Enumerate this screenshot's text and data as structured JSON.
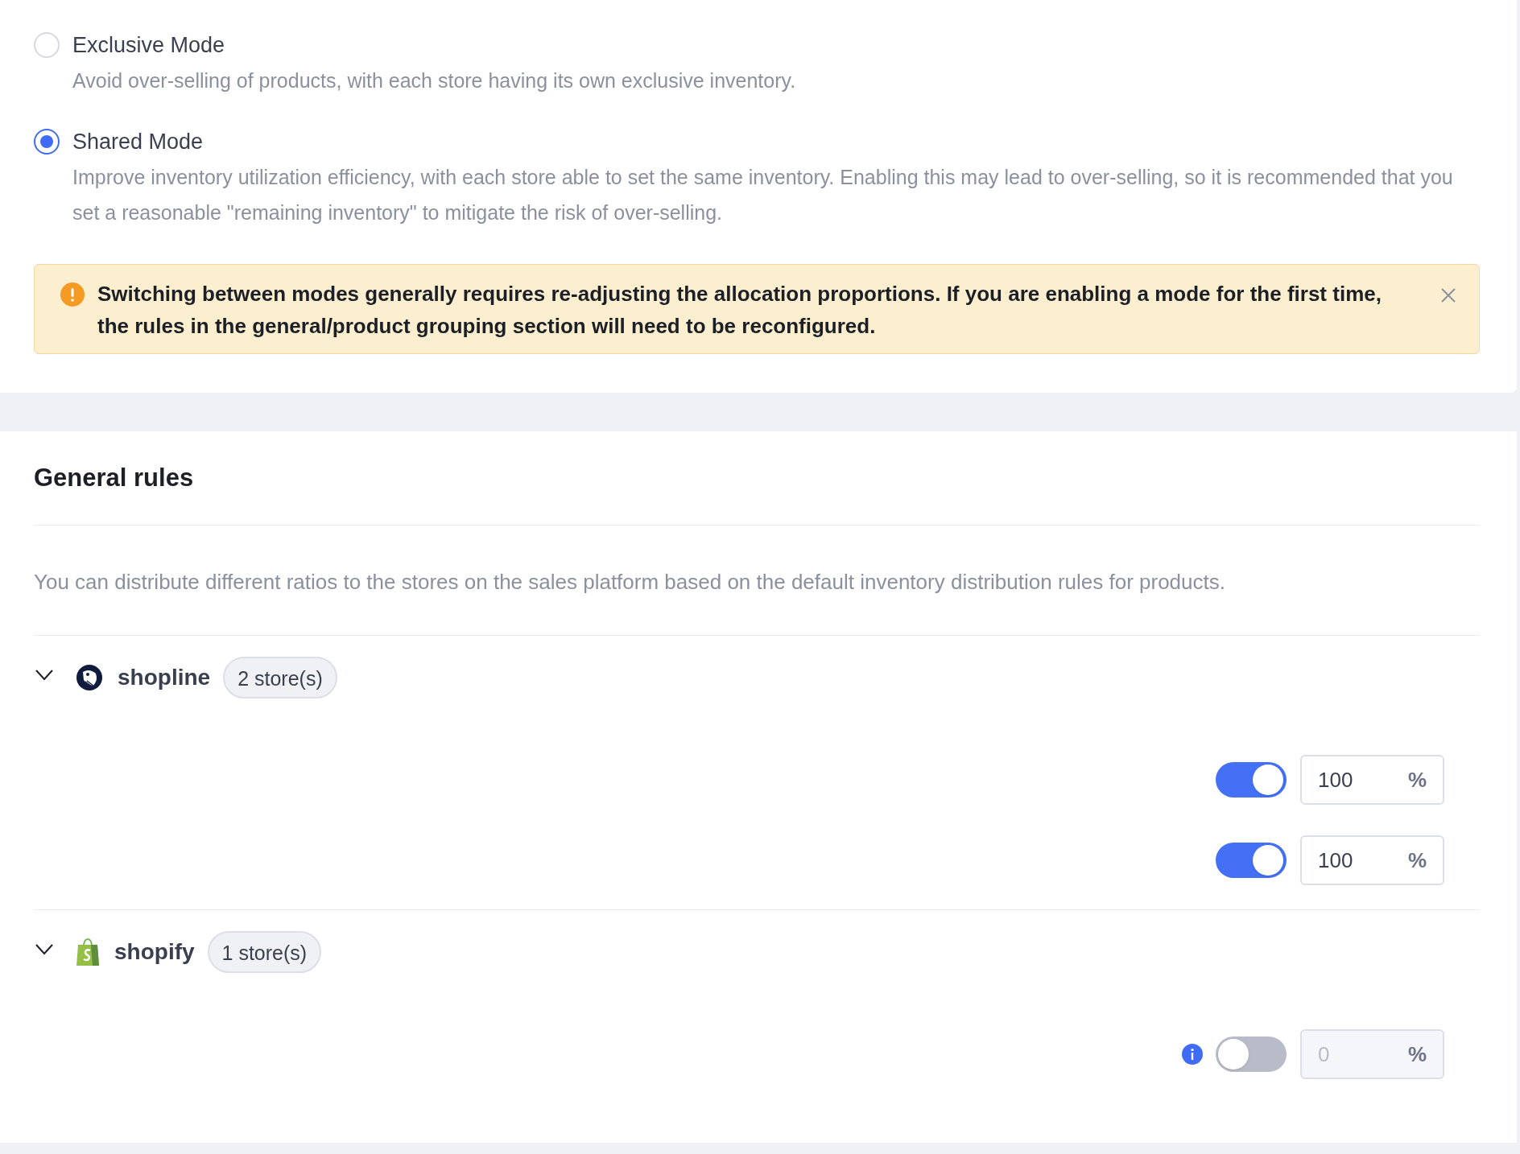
{
  "modes": [
    {
      "label": "Exclusive Mode",
      "description": "Avoid over-selling of products, with each store having its own exclusive inventory.",
      "selected": false
    },
    {
      "label": "Shared Mode",
      "description": "Improve inventory utilization efficiency, with each store able to set the same inventory. Enabling this may lead to over-selling, so it is recommended that you set a reasonable \"remaining inventory\" to mitigate the risk of over-selling.",
      "selected": true
    }
  ],
  "alert": {
    "text": "Switching between modes generally requires re-adjusting the allocation proportions. If you are enabling a mode for the first time, the rules in the general/product grouping section will need to be reconfigured."
  },
  "general_rules": {
    "title": "General rules",
    "description": "You can distribute different ratios to the stores on the sales platform based on the default inventory distribution rules for products.",
    "platforms": [
      {
        "name": "shopline",
        "kind": "shopline",
        "badge": "2 store(s)",
        "expanded": true,
        "stores": [
          {
            "on": true,
            "info": false,
            "value": "100",
            "unit": "%"
          },
          {
            "on": true,
            "info": false,
            "value": "100",
            "unit": "%"
          }
        ]
      },
      {
        "name": "shopify",
        "kind": "shopify",
        "badge": "1 store(s)",
        "expanded": true,
        "stores": [
          {
            "on": false,
            "info": true,
            "value": "0",
            "unit": "%"
          }
        ]
      }
    ]
  }
}
